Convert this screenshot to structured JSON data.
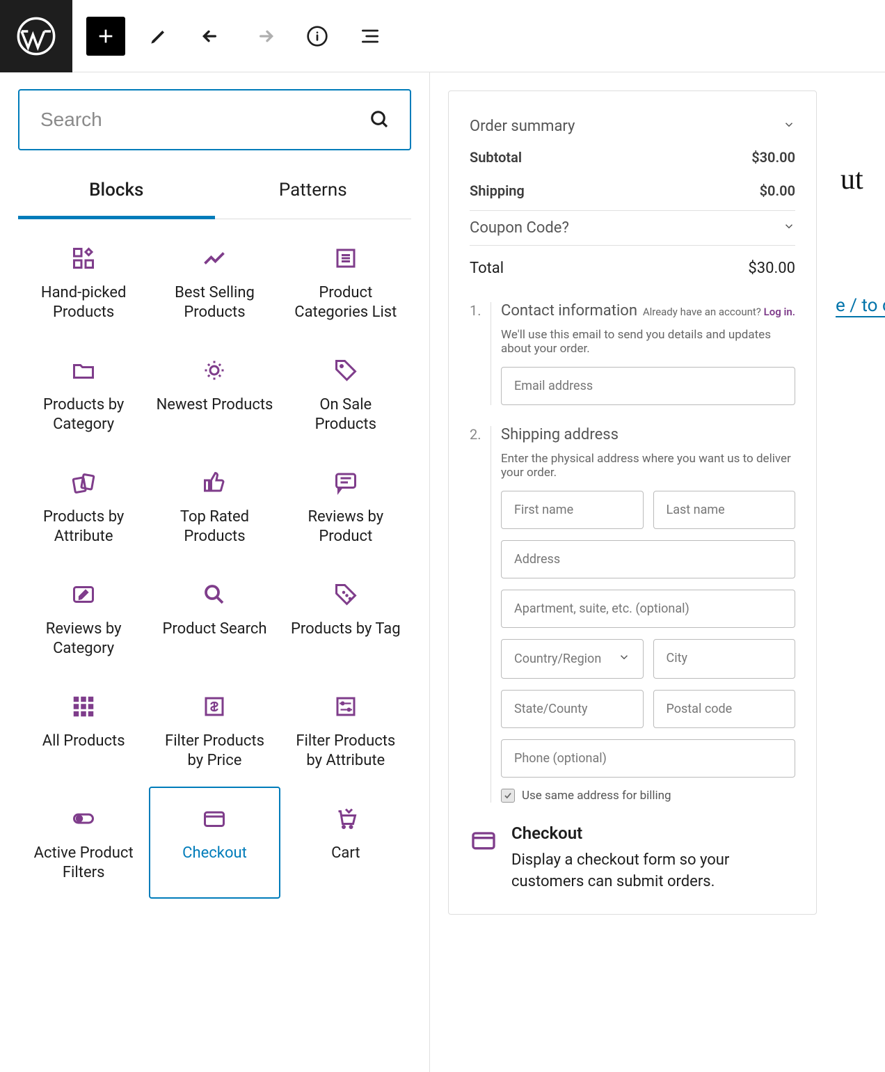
{
  "search": {
    "placeholder": "Search"
  },
  "tabs": {
    "blocks": "Blocks",
    "patterns": "Patterns"
  },
  "blocks": [
    {
      "label": "Hand-picked Products",
      "icon": "grid-plus"
    },
    {
      "label": "Best Selling Products",
      "icon": "trend"
    },
    {
      "label": "Product Categories List",
      "icon": "list-box"
    },
    {
      "label": "Products by Category",
      "icon": "folder"
    },
    {
      "label": "Newest Products",
      "icon": "burst"
    },
    {
      "label": "On Sale Products",
      "icon": "tag"
    },
    {
      "label": "Products by Attribute",
      "icon": "cards"
    },
    {
      "label": "Top Rated Products",
      "icon": "thumb"
    },
    {
      "label": "Reviews by Product",
      "icon": "comment"
    },
    {
      "label": "Reviews by Category",
      "icon": "write"
    },
    {
      "label": "Product Search",
      "icon": "search"
    },
    {
      "label": "Products by Tag",
      "icon": "tag-dots"
    },
    {
      "label": "All Products",
      "icon": "grid9"
    },
    {
      "label": "Filter Products by Price",
      "icon": "price"
    },
    {
      "label": "Filter Products by Attribute",
      "icon": "sliders"
    },
    {
      "label": "Active Product Filters",
      "icon": "toggle"
    },
    {
      "label": "Checkout",
      "icon": "card",
      "selected": true
    },
    {
      "label": "Cart",
      "icon": "cart"
    }
  ],
  "preview": {
    "order_summary_label": "Order summary",
    "subtotal_label": "Subtotal",
    "subtotal_value": "$30.00",
    "shipping_label": "Shipping",
    "shipping_value": "$0.00",
    "coupon_label": "Coupon Code?",
    "total_label": "Total",
    "total_value": "$30.00",
    "step1_num": "1.",
    "step1_title": "Contact information",
    "already_text": "Already have an account? ",
    "login_link": "Log in.",
    "step1_desc": "We'll use this email to send you details and updates about your order.",
    "email_placeholder": "Email address",
    "step2_num": "2.",
    "step2_title": "Shipping address",
    "step2_desc": "Enter the physical address where you want us to deliver your order.",
    "first_name": "First name",
    "last_name": "Last name",
    "address": "Address",
    "apartment": "Apartment, suite, etc. (optional)",
    "country": "Country/Region",
    "city": "City",
    "state": "State/County",
    "postal": "Postal code",
    "phone": "Phone (optional)",
    "billing_checkbox": "Use same address for billing",
    "block_title": "Checkout",
    "block_desc": "Display a checkout form so your customers can submit orders."
  },
  "bg": {
    "t1": "ut",
    "t2": "e / to c"
  }
}
